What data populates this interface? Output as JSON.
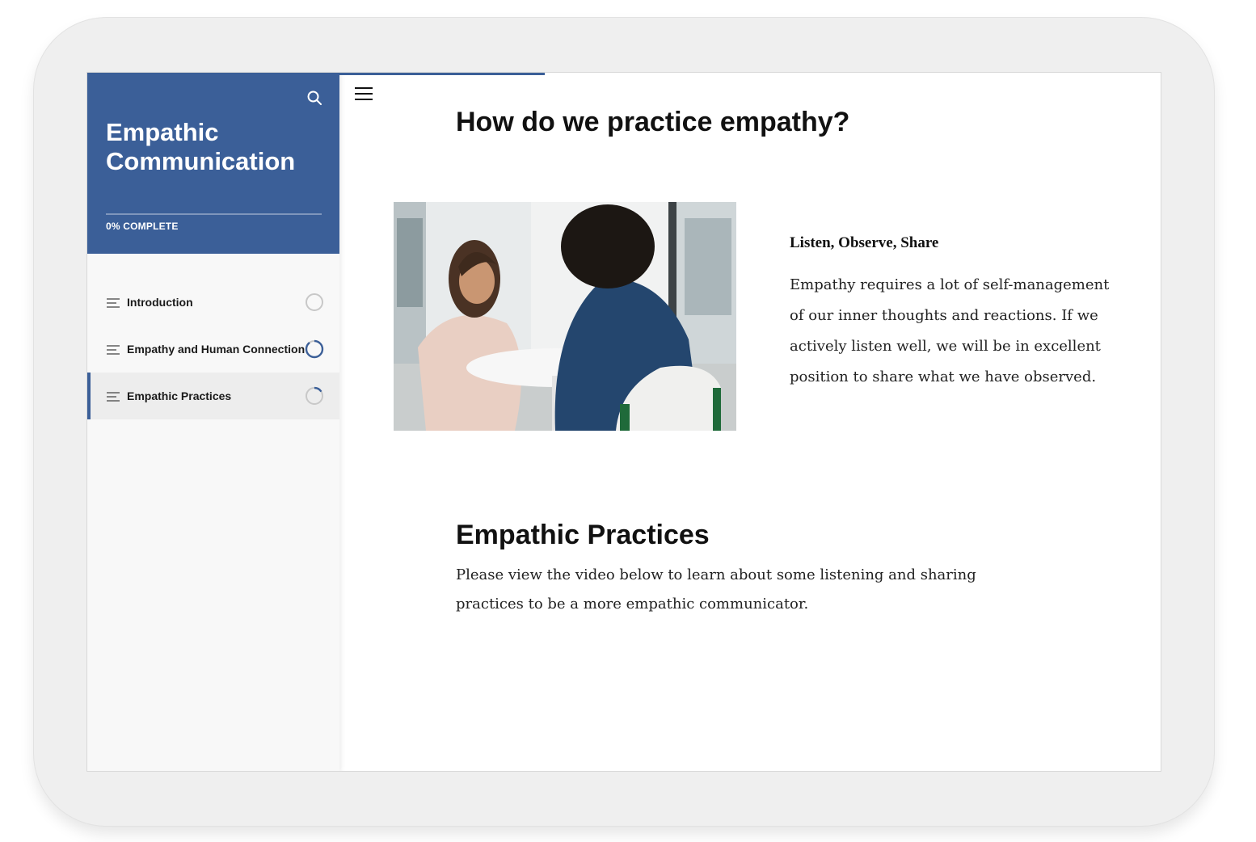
{
  "sidebar": {
    "course_title": "Empathic Communication",
    "progress": {
      "label": "0% COMPLETE",
      "percent": 0
    },
    "lessons": [
      {
        "label": "Introduction",
        "status": "not-started"
      },
      {
        "label": "Empathy and Human Connection",
        "status": "in-progress"
      },
      {
        "label": "Empathic Practices",
        "status": "in-progress",
        "active": true
      }
    ]
  },
  "icons": {
    "search": "search-icon",
    "hamburger": "hamburger-menu-icon",
    "lesson": "lines-icon"
  },
  "colors": {
    "brand": "#3b5f98",
    "sidebar_bg": "#f8f8f8",
    "active_item_bg": "#ededed"
  },
  "main": {
    "heading": "How do we practice empathy?",
    "image": {
      "alt": "Two women talking at a round white table by a window"
    },
    "text_block": {
      "title": "Listen, Observe, Share",
      "body": "Empathy requires a lot of self-management of our inner thoughts and reactions. If we actively listen well, we will be in excellent position to share what we have observed."
    },
    "section2": {
      "heading": "Empathic Practices",
      "body": "Please view the video below to learn about some listening and sharing practices to be a more empathic communicator."
    }
  }
}
